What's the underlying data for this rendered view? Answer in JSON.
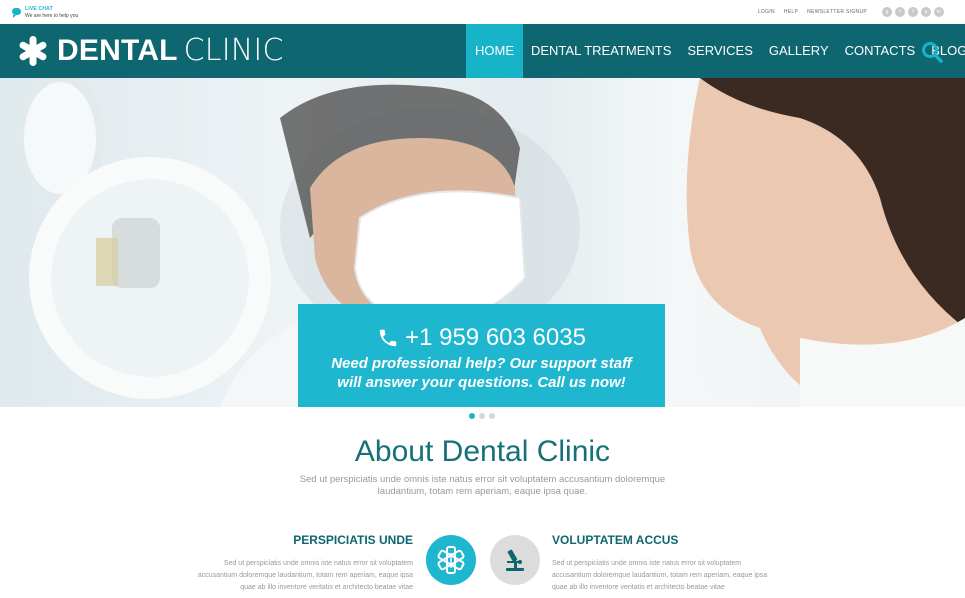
{
  "topbar": {
    "live_chat_title": "LIVE CHAT",
    "live_chat_sub": "We are here to help you",
    "links": [
      "LOGIN",
      "HELP",
      "NEWSLETTER SIGNUP"
    ],
    "socials": [
      "g",
      "t",
      "f",
      "p",
      "in"
    ]
  },
  "logo": {
    "bold": "DENTAL",
    "light": "CLINIC"
  },
  "nav": {
    "items": [
      "HOME",
      "DENTAL TREATMENTS",
      "SERVICES",
      "GALLERY",
      "CONTACTS",
      "BLOG"
    ],
    "active": "HOME"
  },
  "hero": {
    "phone": "+1 959 603 6035",
    "message": "Need professional help? Our support staff will answer your questions. Call us now!"
  },
  "about": {
    "title": "About Dental Clinic",
    "subtitle": "Sed ut perspiciatis unde omnis iste natus error sit voluptatem accusantium doloremque laudantium, totam rem aperiam, eaque ipsa quae.",
    "features": [
      {
        "title": "PERSPICIATIS UNDE",
        "text": "Sed ut perspiciatis unde omnis iste natus error sit voluptatem accusantium doloremque laudantium, totam rem aperiam, eaque ipsa quae ab illo inventore veritatis et  architecto beatae vitae"
      },
      {
        "title": "VOLUPTATEM ACCUS",
        "text": "Sed ut perspiciatis unde omnis iste natus error sit voluptatem accusantium doloremque laudantium, totam rem aperiam, eaque ipsa quae ab illo inventore veritatis et  architecto beatae vitae"
      }
    ]
  },
  "colors": {
    "brand_dark": "#0e6670",
    "accent": "#17b3c9",
    "callout": "#1fb6d0"
  },
  "icons": {
    "medical": "medical-star-icon",
    "microscope": "microscope-icon",
    "search": "search-icon",
    "phone": "phone-icon",
    "chat": "chat-icon"
  }
}
